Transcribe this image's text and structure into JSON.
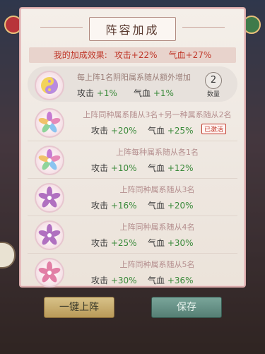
{
  "panel": {
    "title": "阵容加成",
    "summary": {
      "label": "我的加成效果:",
      "atk": "攻击+22%",
      "hp": "气血+27%"
    }
  },
  "rows": [
    {
      "desc": "每上阵1名阴阳属系随从额外增加",
      "atk_label": "攻击",
      "atk_val": "+1%",
      "hp_label": "气血",
      "hp_val": "+1%",
      "icon": "yinyang-icon",
      "qty": "2",
      "qty_label": "数量"
    },
    {
      "desc": "上阵同种属系随从3名+另一种属系随从2名",
      "atk_label": "攻击",
      "atk_val": "+20%",
      "hp_label": "气血",
      "hp_val": "+25%",
      "icon": "flower-icon",
      "badge": "已激活"
    },
    {
      "desc": "上阵每种属系随从各1名",
      "atk_label": "攻击",
      "atk_val": "+10%",
      "hp_label": "气血",
      "hp_val": "+12%",
      "icon": "flower-icon"
    },
    {
      "desc": "上阵同种属系随从3名",
      "atk_label": "攻击",
      "atk_val": "+16%",
      "hp_label": "气血",
      "hp_val": "+20%",
      "icon": "flower-icon"
    },
    {
      "desc": "上阵同种属系随从4名",
      "atk_label": "攻击",
      "atk_val": "+25%",
      "hp_label": "气血",
      "hp_val": "+30%",
      "icon": "flower-icon"
    },
    {
      "desc": "上阵同种属系随从5名",
      "atk_label": "攻击",
      "atk_val": "+30%",
      "hp_label": "气血",
      "hp_val": "+36%",
      "icon": "flower-icon"
    }
  ],
  "buttons": {
    "one_key": "一键上阵",
    "save": "保存"
  },
  "colors": {
    "accent_red": "#c0392b",
    "stat_green": "#3a8a3a",
    "save_btn": "#557f74",
    "one_key_btn": "#b99a58"
  }
}
